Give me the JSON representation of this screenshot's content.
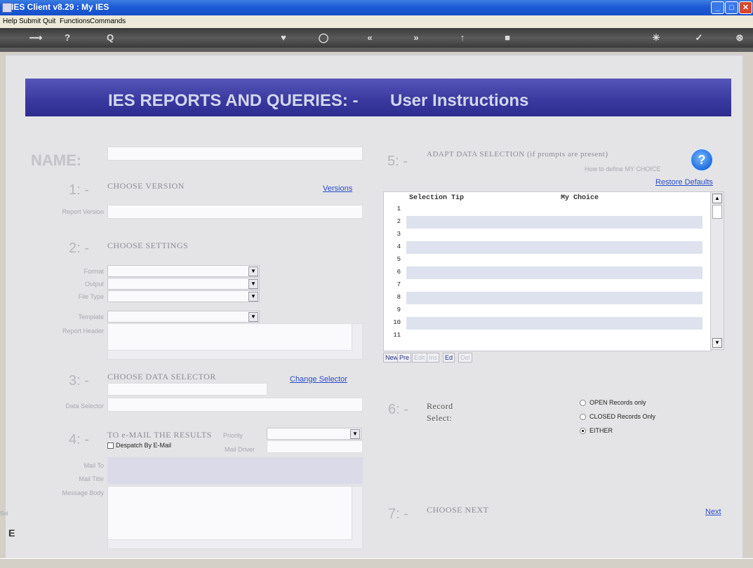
{
  "window": {
    "title": "IES Client v8.29 : My IES",
    "min_label": "_",
    "max_label": "□",
    "close_label": "✕"
  },
  "menubar": {
    "items": [
      "Help",
      "Submit",
      "Quit",
      "Functions",
      "Commands"
    ]
  },
  "toolbar": {
    "icons": [
      "⟿",
      "?",
      "Q",
      "♥",
      "◯",
      "«",
      "»",
      "↑",
      "■",
      "✳",
      "✓",
      "⊗"
    ]
  },
  "banner": {
    "title": "IES REPORTS AND QUERIES: -",
    "subtitle": "User Instructions"
  },
  "name_section": {
    "label": "NAME:",
    "value": ""
  },
  "step1": {
    "number": "1: -",
    "heading": "CHOOSE VERSION",
    "link": "Versions",
    "report_version_label": "Report Version",
    "report_version_value": ""
  },
  "step2": {
    "number": "2: -",
    "heading": "CHOOSE SETTINGS",
    "fields": [
      {
        "label": "Format",
        "value": ""
      },
      {
        "label": "Output",
        "value": ""
      },
      {
        "label": "File Type",
        "value": ""
      },
      {
        "label": "Template",
        "value": ""
      }
    ],
    "report_header_label": "Report Header"
  },
  "step3": {
    "number": "3: -",
    "heading": "CHOOSE DATA SELECTOR",
    "link": "Change Selector",
    "data_selector_label": "Data Selector"
  },
  "step4": {
    "number": "4: -",
    "heading": "TO e-MAIL THE RESULTS",
    "priority_label": "Priority",
    "despatch_label": "Despatch By E-Mail",
    "mail_driver_label": "Mail Driver",
    "mail_to_label": "Mail To",
    "mail_title_label": "Mail Title",
    "message_body_label": "Message Body"
  },
  "step5": {
    "number": "5: -",
    "heading": "ADAPT DATA SELECTION (if prompts are present)",
    "help_text": "How to define MY CHOICE",
    "help_icon": "?",
    "restore_link": "Restore Defaults",
    "grid": {
      "columns": [
        "Selection Tip",
        "My Choice"
      ],
      "rows": [
        "1",
        "2",
        "3",
        "4",
        "5",
        "6",
        "7",
        "8",
        "9",
        "10",
        "11"
      ]
    },
    "grid_buttons": [
      "New",
      "Pre",
      "Edit",
      "Ins",
      "Ed",
      "Del"
    ]
  },
  "step6": {
    "number": "6: -",
    "heading_line1": "Record",
    "heading_line2": "Select:",
    "options": [
      {
        "label": "OPEN Records only",
        "selected": false
      },
      {
        "label": "CLOSED Records Only",
        "selected": false
      },
      {
        "label": "EITHER",
        "selected": true
      }
    ]
  },
  "step7": {
    "number": "7: -",
    "heading": "CHOOSE NEXT",
    "link": "Next"
  },
  "left_edge": {
    "label": "Sel",
    "glyph": "E"
  },
  "colors": {
    "banner": "#3a3aa0",
    "link": "#2a4cc8",
    "titlebar": "#1c5ad8",
    "panel": "#e4e4e6"
  }
}
